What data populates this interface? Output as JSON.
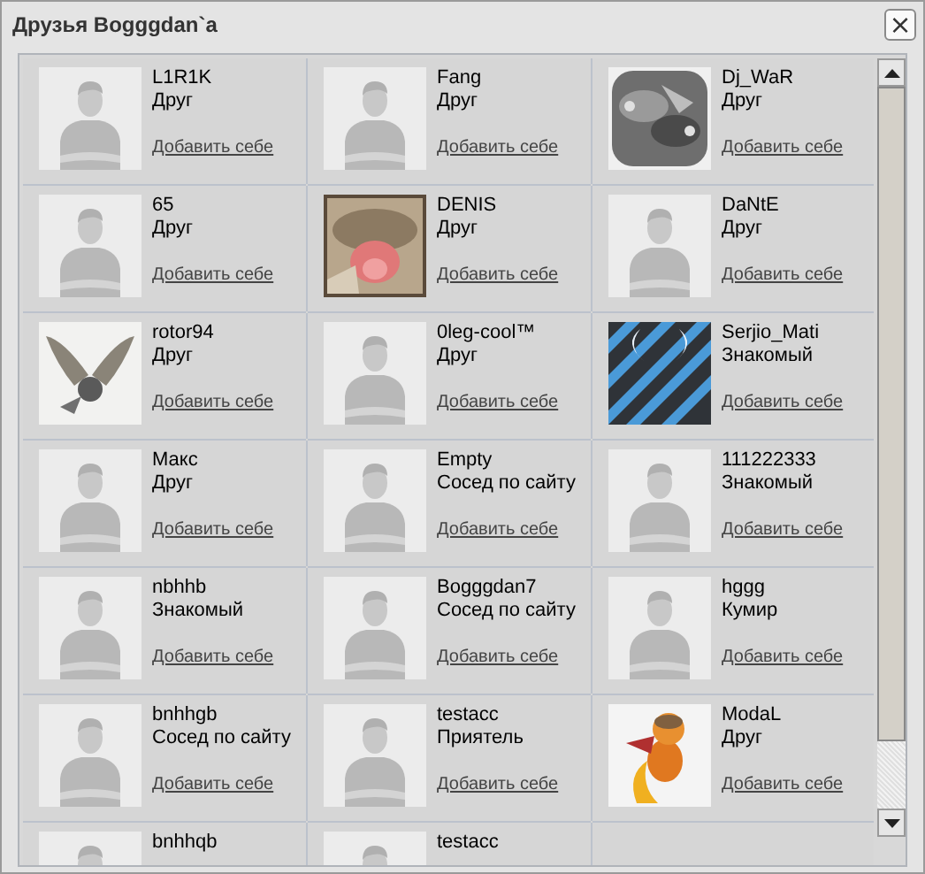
{
  "window": {
    "title": "Друзья Bogggdan`a",
    "close": "×"
  },
  "friends": [
    {
      "name": "L1R1K",
      "relation": "Друг",
      "action": "Добавить себе",
      "avatar": {
        "kind": "default"
      }
    },
    {
      "name": "Fang",
      "relation": "Друг",
      "action": "Добавить себе",
      "avatar": {
        "kind": "default"
      }
    },
    {
      "name": "Dj_WaR",
      "relation": "Друг",
      "action": "Добавить себе"
    },
    {
      "name": "65",
      "relation": "Друг",
      "action": "Добавить себе",
      "avatar": {
        "kind": "default"
      }
    },
    {
      "name": "DENIS",
      "relation": "Друг",
      "action": "Добавить себе"
    },
    {
      "name": "DaNtE",
      "relation": "Друг",
      "action": "Добавить себе",
      "avatar": {
        "kind": "default"
      }
    },
    {
      "name": "rotor94",
      "relation": "Друг",
      "action": "Добавить себе"
    },
    {
      "name": "0leg-cool™",
      "relation": "Друг",
      "action": "Добавить себе",
      "avatar": {
        "kind": "default"
      }
    },
    {
      "name": "Serjio_Mati",
      "relation": "Знакомый",
      "action": "Добавить себе"
    },
    {
      "name": "Макс",
      "relation": "Друг",
      "action": "Добавить себе",
      "avatar": {
        "kind": "default"
      }
    },
    {
      "name": "Empty",
      "relation": "Сосед по сайту",
      "action": "Добавить себе",
      "avatar": {
        "kind": "default"
      }
    },
    {
      "name": "111222333",
      "relation": "Знакомый",
      "action": "Добавить себе",
      "avatar": {
        "kind": "default"
      }
    },
    {
      "name": "nbhhb",
      "relation": "Знакомый",
      "action": "Добавить себе",
      "avatar": {
        "kind": "default"
      }
    },
    {
      "name": "Bogggdan7",
      "relation": "Сосед по сайту",
      "action": "Добавить себе",
      "avatar": {
        "kind": "default"
      }
    },
    {
      "name": "hggg",
      "relation": "Кумир",
      "action": "Добавить себе",
      "avatar": {
        "kind": "default"
      }
    },
    {
      "name": "bnhhgb",
      "relation": "Сосед по сайту",
      "action": "Добавить себе",
      "avatar": {
        "kind": "default"
      }
    },
    {
      "name": "testacc",
      "relation": "Приятель",
      "action": "Добавить себе",
      "avatar": {
        "kind": "default"
      }
    },
    {
      "name": "ModaL",
      "relation": "Друг",
      "action": "Добавить себе"
    },
    {
      "name": "bnhhqb",
      "avatar": {
        "kind": "default"
      }
    },
    {
      "name": "testacc",
      "avatar": {
        "kind": "default"
      }
    }
  ]
}
